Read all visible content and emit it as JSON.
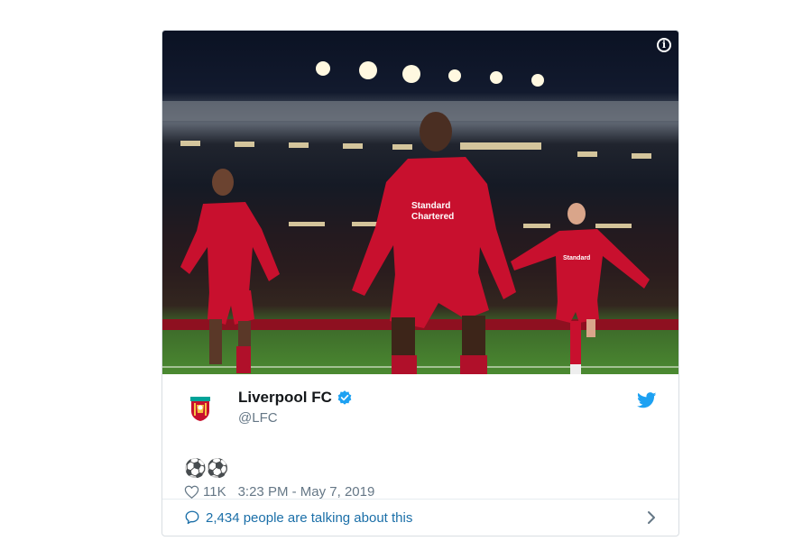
{
  "tweet": {
    "display_name": "Liverpool FC",
    "handle": "@LFC",
    "text": "⚽⚽",
    "like_count": "11K",
    "timestamp": "3:23 PM - May 7, 2019",
    "talking": "2,434 people are talking about this"
  },
  "media": {
    "shirt_sponsor": "Standard Chartered",
    "kit_color": "#c8102e",
    "pitch_color": "#4b8a31"
  },
  "icons": {
    "info": "info-icon",
    "verified": "verified-badge-icon",
    "bird": "twitter-bird-icon",
    "heart": "heart-icon",
    "comment": "comment-bubble-icon",
    "chevron": "chevron-right-icon"
  },
  "colors": {
    "twitter_blue": "#1da1f2",
    "link_blue": "#1b6fa8",
    "muted": "#657786"
  }
}
